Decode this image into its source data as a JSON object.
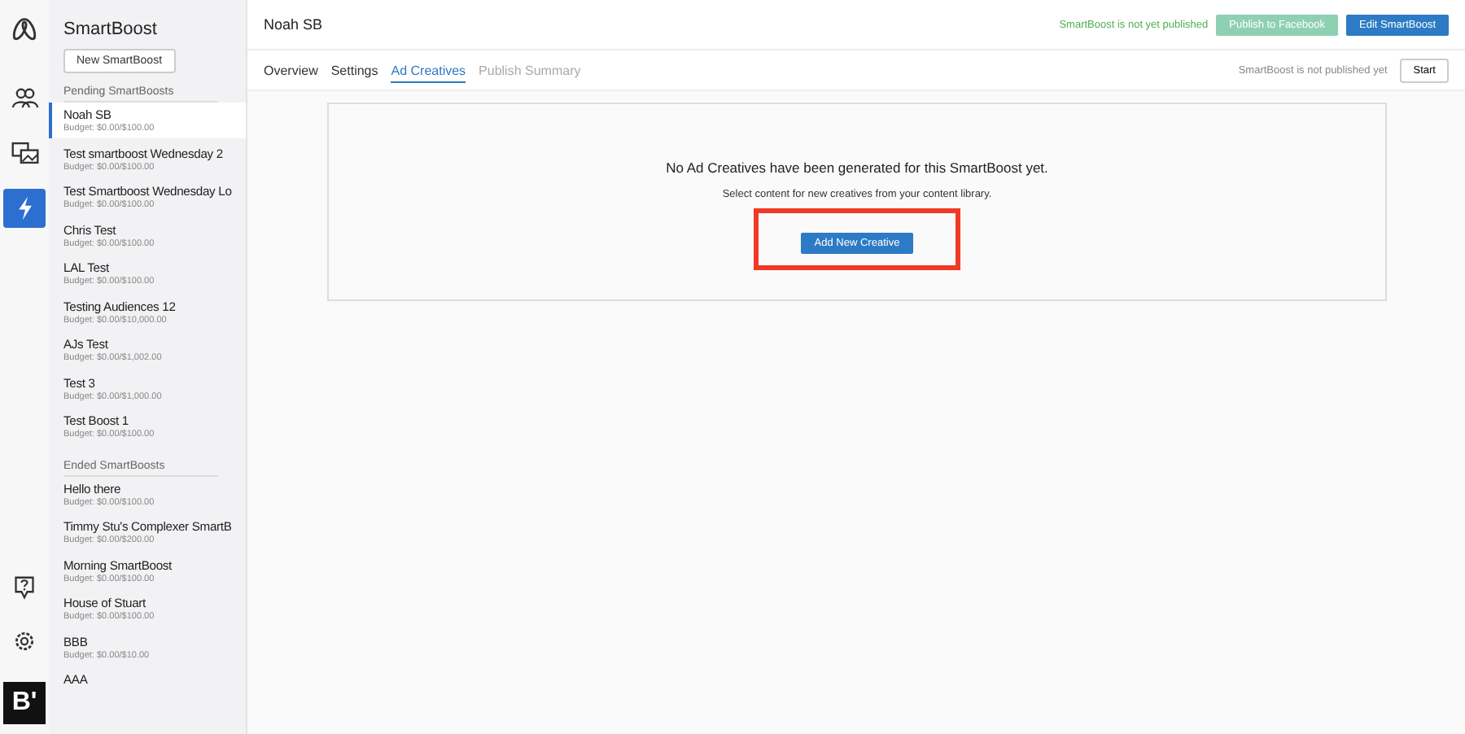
{
  "rail": {
    "top": [
      {
        "selected": false
      },
      {
        "selected": false
      },
      {
        "selected": true
      }
    ],
    "brand": "B'"
  },
  "sidebar": {
    "title": "SmartBoost",
    "new_button": "New SmartBoost",
    "groups": [
      {
        "heading": "Pending SmartBoosts",
        "items": [
          {
            "name": "Noah SB",
            "budget": "Budget: $0.00/$100.00",
            "selected": true
          },
          {
            "name": "Test smartboost Wednesday 2",
            "budget": "Budget: $0.00/$100.00",
            "selected": false
          },
          {
            "name": "Test Smartboost Wednesday Lo",
            "budget": "Budget: $0.00/$100.00",
            "selected": false
          },
          {
            "name": "Chris Test",
            "budget": "Budget: $0.00/$100.00",
            "selected": false
          },
          {
            "name": "LAL Test",
            "budget": "Budget: $0.00/$100.00",
            "selected": false
          },
          {
            "name": "Testing Audiences 12",
            "budget": "Budget: $0.00/$10,000.00",
            "selected": false
          },
          {
            "name": "AJs Test",
            "budget": "Budget: $0.00/$1,002.00",
            "selected": false
          },
          {
            "name": "Test 3",
            "budget": "Budget: $0.00/$1,000.00",
            "selected": false
          },
          {
            "name": "Test Boost 1",
            "budget": "Budget: $0.00/$100.00",
            "selected": false
          }
        ]
      },
      {
        "heading": "Ended SmartBoosts",
        "items": [
          {
            "name": "Hello there",
            "budget": "Budget: $0.00/$100.00",
            "selected": false
          },
          {
            "name": "Timmy Stu's Complexer SmartB",
            "budget": "Budget: $0.00/$200.00",
            "selected": false
          },
          {
            "name": "Morning SmartBoost",
            "budget": "Budget: $0.00/$100.00",
            "selected": false
          },
          {
            "name": "House of Stuart",
            "budget": "Budget: $0.00/$100.00",
            "selected": false
          },
          {
            "name": "BBB",
            "budget": "Budget: $0.00/$10.00",
            "selected": false
          },
          {
            "name": "AAA",
            "selected": false
          }
        ]
      }
    ]
  },
  "header": {
    "title": "Noah SB",
    "status": "SmartBoost is not yet published",
    "publish_button": {
      "label": "Publish to Facebook",
      "disabled": true
    },
    "edit_button": "Edit SmartBoost"
  },
  "tabs": [
    {
      "label": "Overview",
      "selected": false,
      "disabled": false
    },
    {
      "label": "Settings",
      "selected": false,
      "disabled": false
    },
    {
      "label": "Ad Creatives",
      "selected": true,
      "disabled": false
    },
    {
      "label": "Publish Summary",
      "selected": false,
      "disabled": true
    }
  ],
  "tab_status": "SmartBoost is not published yet",
  "start_button": "Start",
  "empty_state": {
    "heading": "No Ad Creatives have been generated for this SmartBoost yet.",
    "text": "Select content for new creatives from your content library.",
    "button": {
      "label": "Add New Creative",
      "highlighted": true
    }
  }
}
